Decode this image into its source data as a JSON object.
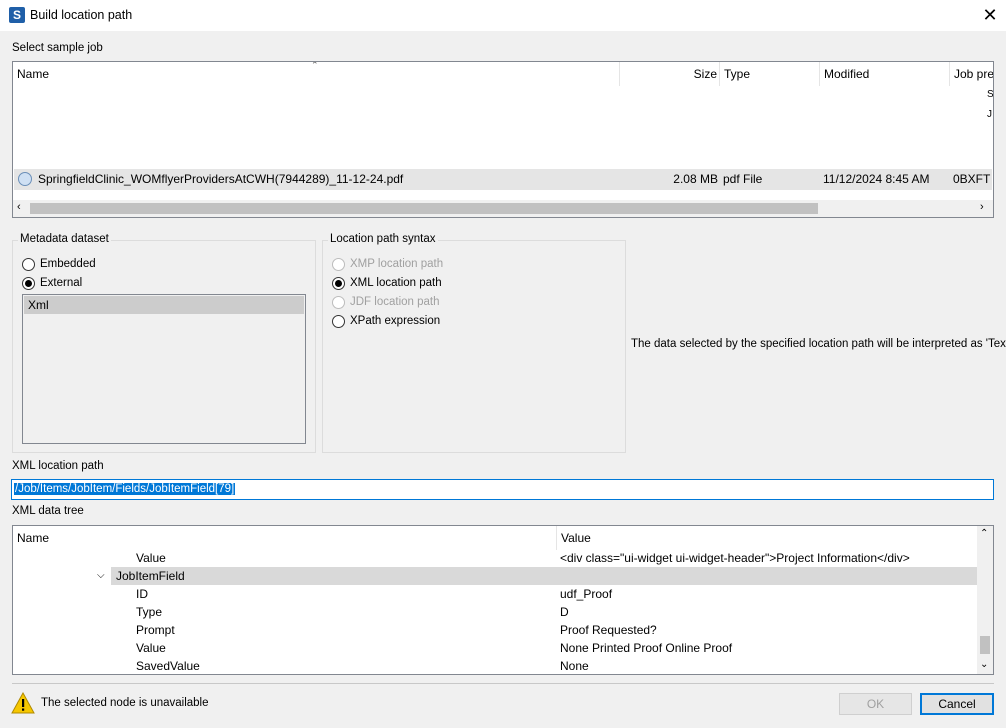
{
  "window": {
    "title": "Build location path",
    "app_icon": "S",
    "close_icon": "close-icon"
  },
  "sample_job": {
    "label": "Select sample job",
    "columns": {
      "name": "Name",
      "size": "Size",
      "type": "Type",
      "modified": "Modified",
      "job_prefix": "Job pre"
    },
    "row": {
      "name": "SpringfieldClinic_WOMflyerProvidersAtCWH(7944289)_11-12-24.pdf",
      "size": "2.08 MB",
      "type": "pdf File",
      "modified": "11/12/2024 8:45 AM",
      "job_prefix": "0BXFT"
    },
    "overflow_chars": [
      "S",
      "J"
    ]
  },
  "metadata_dataset": {
    "title": "Metadata dataset",
    "options": [
      {
        "label": "Embedded",
        "selected": false
      },
      {
        "label": "External",
        "selected": true
      }
    ],
    "list_items": [
      "Xml"
    ]
  },
  "location_syntax": {
    "title": "Location path syntax",
    "options": [
      {
        "label": "XMP location path",
        "selected": false,
        "disabled": true
      },
      {
        "label": "XML location path",
        "selected": true,
        "disabled": false
      },
      {
        "label": "JDF location path",
        "selected": false,
        "disabled": true
      },
      {
        "label": "XPath expression",
        "selected": false,
        "disabled": false
      }
    ]
  },
  "interpretation_note": "The data selected by the specified location path will be interpreted as 'Text'",
  "xml_location_path": {
    "label": "XML location path",
    "value": "/Job/Items/JobItem/Fields/JobItemField[79]"
  },
  "xml_data_tree": {
    "label": "XML data tree",
    "columns": {
      "name": "Name",
      "value": "Value"
    },
    "rows": [
      {
        "name": "Value",
        "value": "<div class=\"ui-widget ui-widget-header\">Project Information</div>"
      },
      {
        "name": "JobItemField",
        "value": ""
      },
      {
        "name": "ID",
        "value": "udf_Proof"
      },
      {
        "name": "Type",
        "value": "D"
      },
      {
        "name": "Prompt",
        "value": "Proof Requested?"
      },
      {
        "name": "Value",
        "value": "None Printed Proof Online Proof"
      },
      {
        "name": "SavedValue",
        "value": "None"
      }
    ]
  },
  "status": {
    "message": "The selected node is unavailable",
    "icon": "warning-icon"
  },
  "buttons": {
    "ok": "OK",
    "cancel": "Cancel"
  }
}
